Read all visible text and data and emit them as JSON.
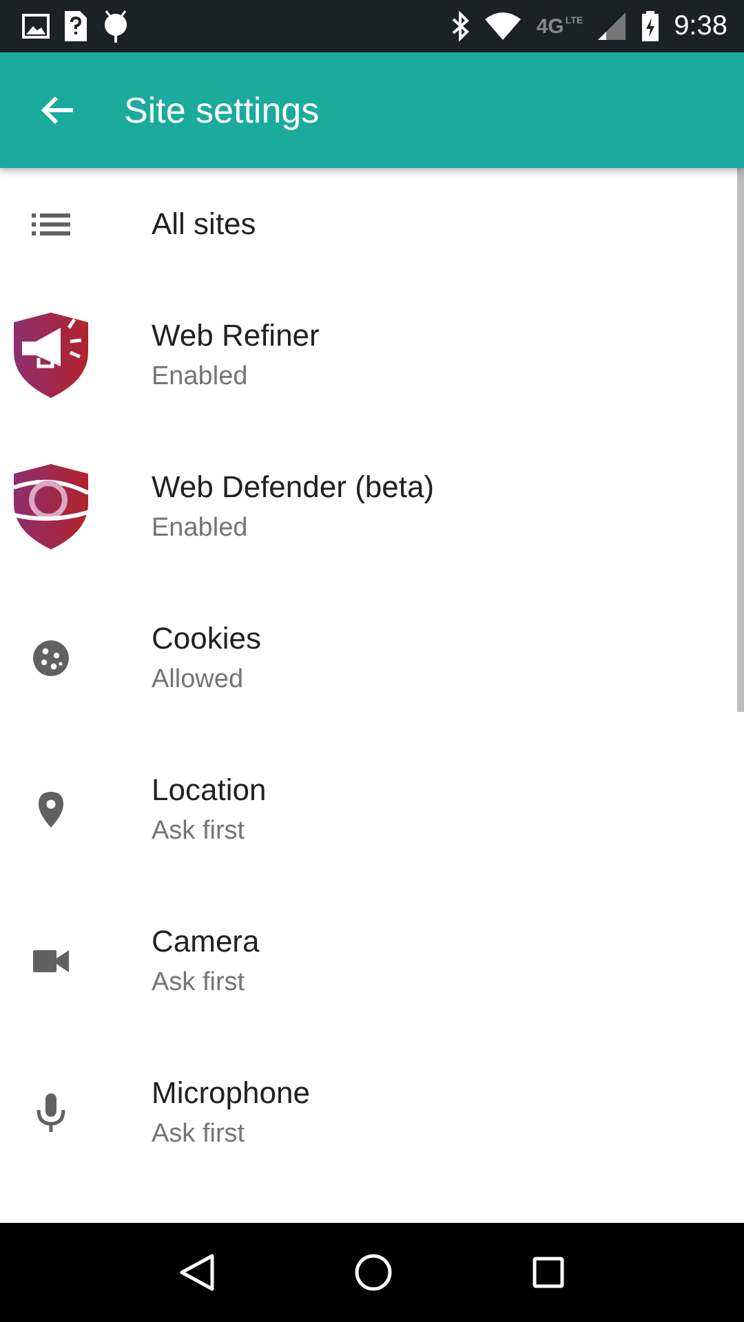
{
  "status_bar": {
    "network": "4G",
    "network_sub": "LTE",
    "time": "9:38"
  },
  "toolbar": {
    "title": "Site settings"
  },
  "items": [
    {
      "kind": "list",
      "title": "All sites"
    },
    {
      "kind": "refiner",
      "title": "Web Refiner",
      "subtitle": "Enabled"
    },
    {
      "kind": "defender",
      "title": "Web Defender (beta)",
      "subtitle": "Enabled"
    },
    {
      "kind": "cookies",
      "title": "Cookies",
      "subtitle": "Allowed"
    },
    {
      "kind": "location",
      "title": "Location",
      "subtitle": "Ask first"
    },
    {
      "kind": "camera",
      "title": "Camera",
      "subtitle": "Ask first"
    },
    {
      "kind": "microphone",
      "title": "Microphone",
      "subtitle": "Ask first"
    }
  ]
}
